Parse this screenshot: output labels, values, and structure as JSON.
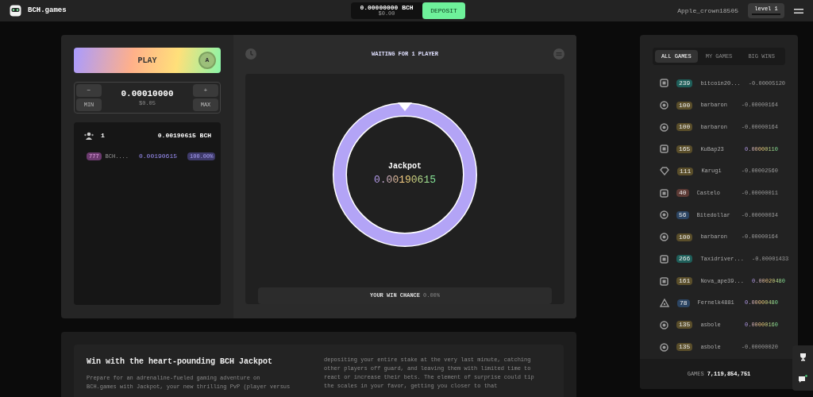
{
  "header": {
    "logo": "BCH.games",
    "balance": "0.00000000 BCH",
    "balance_usd": "$0.00",
    "deposit": "DEPOSIT",
    "username": "Apple_crown18505",
    "level": "level 1"
  },
  "game": {
    "play": "PLAY",
    "auto_label": "A",
    "amount": "0.00010000",
    "amount_usd": "$0.05",
    "minus": "−",
    "plus": "+",
    "min": "MIN",
    "max": "MAX",
    "players_count": "1",
    "pot": "0.00190615 BCH",
    "entries": [
      {
        "level": "777",
        "color": "#6b3a6e",
        "name": "BCH....",
        "amount": "0.00190615",
        "share": "100.00%"
      }
    ],
    "status": "WAITING FOR 1 PLAYER",
    "wheel_title": "Jackpot",
    "wheel_amount": "0.00190615",
    "win_chance_label": "YOUR WIN CHANCE",
    "win_chance": "0.00%"
  },
  "feed": {
    "tabs": [
      {
        "label": "ALL GAMES",
        "selected": true
      },
      {
        "label": "MY GAMES",
        "selected": false
      },
      {
        "label": "BIG WINS",
        "selected": false
      }
    ],
    "rows": [
      {
        "kind": "square",
        "level": "239",
        "color": "#1f5f5a",
        "name": "bitcoin20...",
        "amount": "-0.00005120",
        "win": false
      },
      {
        "kind": "circle",
        "level": "100",
        "color": "#5a4e2a",
        "name": "barbaron",
        "amount": "-0.00000164",
        "win": false
      },
      {
        "kind": "circle",
        "level": "100",
        "color": "#5a4e2a",
        "name": "barbaron",
        "amount": "-0.00000164",
        "win": false
      },
      {
        "kind": "square",
        "level": "165",
        "color": "#5a4e2a",
        "name": "KuBap23",
        "amount": "0.00000110",
        "win": true
      },
      {
        "kind": "diamond",
        "level": "111",
        "color": "#5a4e2a",
        "name": "Karugi",
        "amount": "-0.00002560",
        "win": false
      },
      {
        "kind": "square",
        "level": "40",
        "color": "#5c3a35",
        "name": "Castelo",
        "amount": "-0.00000011",
        "win": false
      },
      {
        "kind": "circle",
        "level": "56",
        "color": "#2c4563",
        "name": "Bitedollar",
        "amount": "-0.00000034",
        "win": false
      },
      {
        "kind": "circle",
        "level": "100",
        "color": "#5a4e2a",
        "name": "barbaron",
        "amount": "-0.00000164",
        "win": false
      },
      {
        "kind": "square",
        "level": "266",
        "color": "#1f5f5a",
        "name": "Taxidriver...",
        "amount": "-0.00001433",
        "win": false
      },
      {
        "kind": "square",
        "level": "161",
        "color": "#5a4e2a",
        "name": "Nova_ape39...",
        "amount": "0.00020480",
        "win": true
      },
      {
        "kind": "triangle",
        "level": "78",
        "color": "#2c4563",
        "name": "Fernelk4881",
        "amount": "0.00000480",
        "win": true
      },
      {
        "kind": "circle",
        "level": "135",
        "color": "#5a4e2a",
        "name": "asbole",
        "amount": "0.00000160",
        "win": true
      },
      {
        "kind": "circle",
        "level": "135",
        "color": "#5a4e2a",
        "name": "asbole",
        "amount": "-0.00000020",
        "win": false
      }
    ],
    "games_label": "GAMES",
    "games_count": "7,119,854,751"
  },
  "article": {
    "title": "Win with the heart-pounding BCH Jackpot",
    "left": "Prepare for an adrenaline-fueled gaming adventure on BCH.games with Jackpot, your new thrilling PvP (player versus",
    "right": "depositing your entire stake at the very last minute, catching other players off guard, and leaving them with limited time to react or increase their bets. The element of surprise could tip the scales in your favor, getting you closer to that"
  }
}
